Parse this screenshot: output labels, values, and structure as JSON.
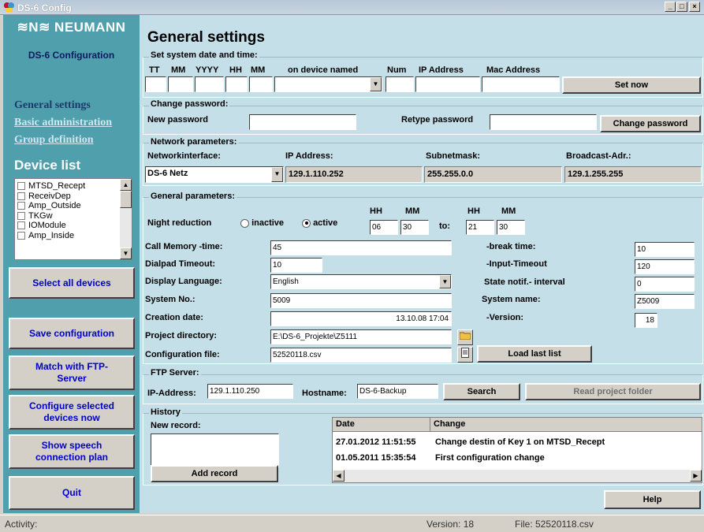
{
  "window": {
    "title": "DS-6 Config",
    "min": "_",
    "max": "□",
    "close": "×"
  },
  "sidebar": {
    "brand": "≋N≋ NEUMANN",
    "product": "DS-6 Configuration",
    "nav": [
      "General settings",
      "Basic administration",
      "Group definition"
    ],
    "device_list_title": "Device list",
    "devices": [
      "MTSD_Recept",
      "ReceivDep",
      "Amp_Outside",
      "TKGw",
      "IOModule",
      "Amp_Inside"
    ],
    "buttons": {
      "select_all": "Select all devices",
      "save": "Save configuration",
      "match_ftp": "Match with FTP-Server",
      "configure": "Configure selected devices now",
      "speech_plan": "Show speech connection plan",
      "quit": "Quit"
    }
  },
  "main": {
    "title": "General settings",
    "datetime": {
      "heading": "Set system date and time:",
      "cols": {
        "tt": "TT",
        "mm": "MM",
        "yyyy": "YYYY",
        "hh": "HH",
        "min": "MM",
        "device": "on device named",
        "num": "Num",
        "ip": "IP Address",
        "mac": "Mac Address"
      },
      "set_now": "Set now"
    },
    "password": {
      "heading": "Change password:",
      "new_label": "New password",
      "retype_label": "Retype password",
      "button": "Change password"
    },
    "network": {
      "heading": "Network parameters:",
      "iface_label": "Networkinterface:",
      "ip_label": "IP Address:",
      "subnet_label": "Subnetmask:",
      "broadcast_label": "Broadcast-Adr.:",
      "iface_value": "DS-6 Netz",
      "ip_value": "129.1.110.252",
      "subnet_value": "255.255.0.0",
      "broadcast_value": "129.1.255.255"
    },
    "general": {
      "heading": "General parameters:",
      "night_label": "Night reduction",
      "inactive": "inactive",
      "active": "active",
      "hh": "HH",
      "mm": "MM",
      "to": "to:",
      "from_hh": "06",
      "from_mm": "30",
      "to_hh": "21",
      "to_mm": "30",
      "call_memory_label": "Call Memory -time:",
      "call_memory": "45",
      "dialpad_label": "Dialpad Timeout:",
      "dialpad": "10",
      "language_label": "Display Language:",
      "language": "English",
      "sysno_label": "System No.:",
      "sysno": "5009",
      "creation_label": "Creation date:",
      "creation": "13.10.08 17:04",
      "projdir_label": "Project directory:",
      "projdir": "E:\\DS-6_Projekte\\Z5111",
      "configfile_label": "Configuration file:",
      "configfile": "52520118.csv",
      "load_last": "Load last list",
      "break_label": "-break time:",
      "break": "10",
      "input_label": "-Input-Timeout",
      "input": "120",
      "state_label": "State notif.- interval",
      "state": "0",
      "sysname_label": "System name:",
      "sysname": "Z5009",
      "version_label": "-Version:",
      "version": "18"
    },
    "ftp": {
      "heading": "FTP Server:",
      "ip_label": "IP-Address:",
      "ip": "129.1.110.250",
      "host_label": "Hostname:",
      "host": "DS-6-Backup",
      "search": "Search",
      "read_folder": "Read project folder"
    },
    "history": {
      "heading": "History",
      "new_record": "New record:",
      "add_record": "Add record",
      "col_date": "Date",
      "col_change": "Change",
      "rows": [
        {
          "date": "27.01.2012 11:51:55",
          "change": "Change destin of Key 1 on MTSD_Recept"
        },
        {
          "date": "01.05.2011 15:35:54",
          "change": "First configuration change"
        }
      ]
    },
    "help": "Help"
  },
  "status": {
    "activity": "Activity:",
    "version": "Version:  18",
    "file": "File:  52520118.csv"
  },
  "colors": {
    "sidebar": "#4f9fac",
    "main": "#c5dfe8",
    "link": "#0000cc"
  }
}
